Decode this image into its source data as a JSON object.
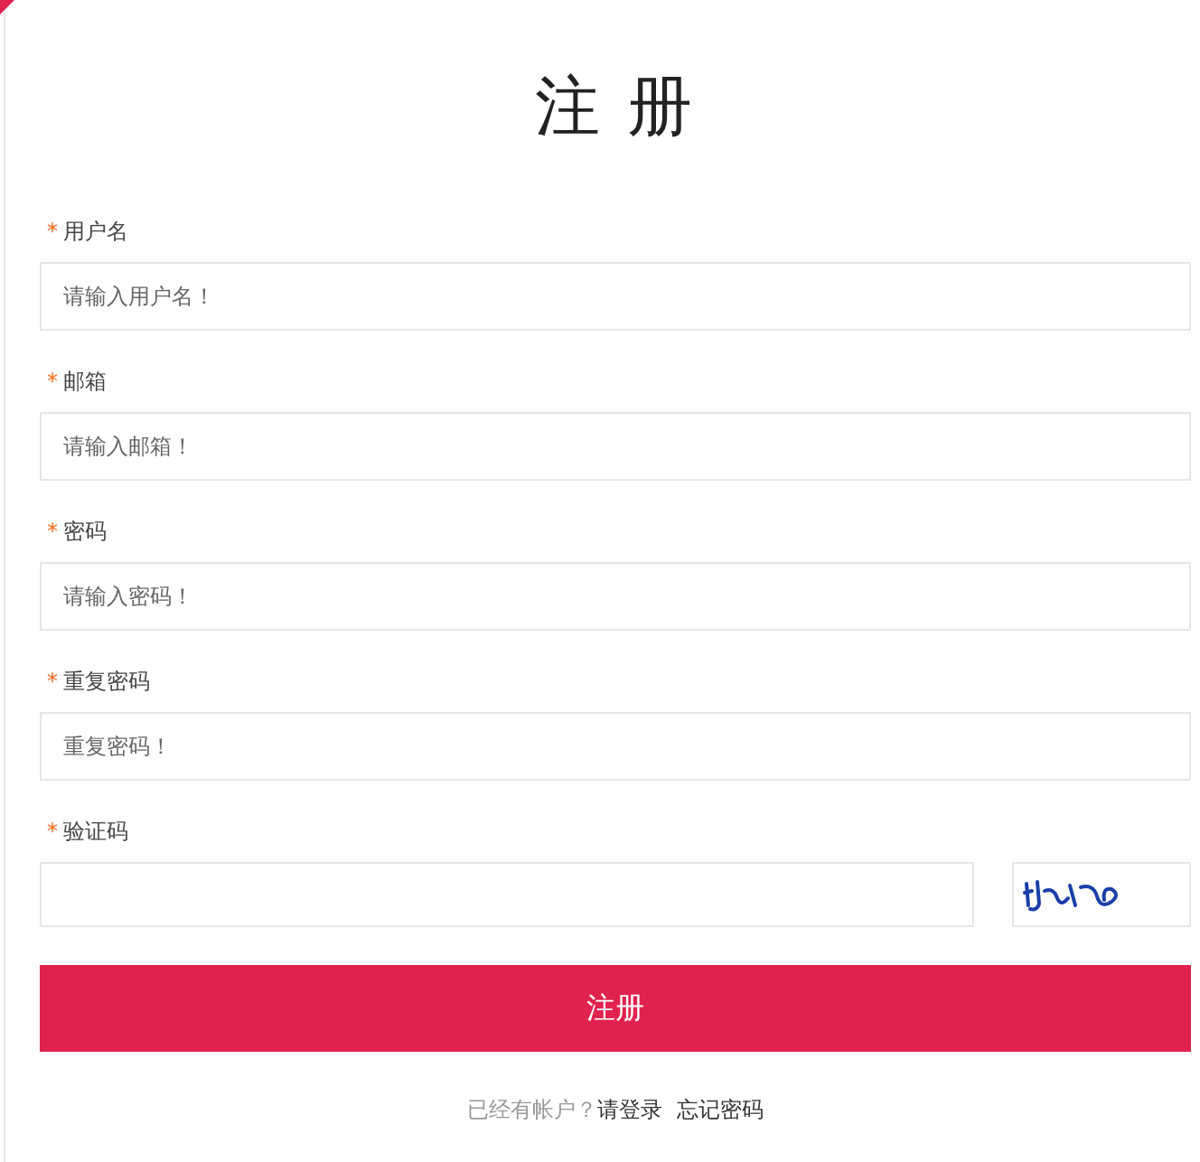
{
  "title": "注 册",
  "fields": [
    {
      "kind": "text",
      "required_mark": "*",
      "label": "用户名",
      "placeholder": "请输入用户名！"
    },
    {
      "kind": "text",
      "required_mark": "*",
      "label": "邮箱",
      "placeholder": "请输入邮箱！"
    },
    {
      "kind": "text",
      "required_mark": "*",
      "label": "密码",
      "placeholder": "请输入密码！"
    },
    {
      "kind": "text",
      "required_mark": "*",
      "label": "重复密码",
      "placeholder": "重复密码！"
    },
    {
      "kind": "captcha",
      "required_mark": "*",
      "label": "验证码"
    }
  ],
  "submit_button": "注册",
  "footer": {
    "prompt": "已经有帐户？",
    "login_link": "请登录",
    "forgot_link": "忘记密码"
  }
}
